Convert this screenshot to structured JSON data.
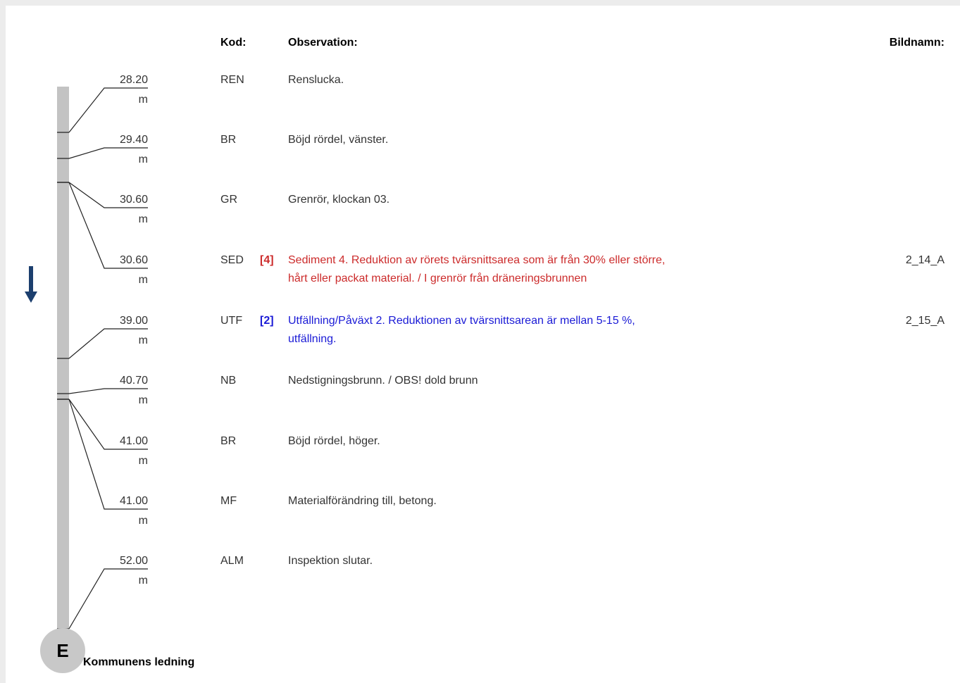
{
  "headers": {
    "code": "Kod:",
    "observation": "Observation:",
    "image_name": "Bildnamn:"
  },
  "colors": {
    "pipe": "#c3c3c3",
    "grade_4": "#cc2b2b",
    "grade_2": "#1a1ad6",
    "arrow": "#1c3f6e"
  },
  "rows": [
    {
      "distance": "28.20",
      "unit": "m",
      "code": "REN",
      "grade": "",
      "observation": "Renslucka.",
      "image": "",
      "color": ""
    },
    {
      "distance": "29.40",
      "unit": "m",
      "code": "BR",
      "grade": "",
      "observation": "Böjd rördel, vänster.",
      "image": "",
      "color": ""
    },
    {
      "distance": "30.60",
      "unit": "m",
      "code": "GR",
      "grade": "",
      "observation": "Grenrör, klockan 03.",
      "image": "",
      "color": ""
    },
    {
      "distance": "30.60",
      "unit": "m",
      "code": "SED",
      "grade": "[4]",
      "observation": "Sediment 4. Reduktion av rörets tvärsnittsarea som är från 30% eller större, hårt eller packat material. / I grenrör från dräneringsbrunnen",
      "image": "2_14_A",
      "color": "grade_4"
    },
    {
      "distance": "39.00",
      "unit": "m",
      "code": "UTF",
      "grade": "[2]",
      "observation": "Utfällning/Påväxt 2. Reduktionen av tvärsnittsarean är mellan 5-15 %, utfällning.",
      "image": "2_15_A",
      "color": "grade_2"
    },
    {
      "distance": "40.70",
      "unit": "m",
      "code": "NB",
      "grade": "",
      "observation": "Nedstigningsbrunn. / OBS! dold brunn",
      "image": "",
      "color": ""
    },
    {
      "distance": "41.00",
      "unit": "m",
      "code": "BR",
      "grade": "",
      "observation": "Böjd rördel, höger.",
      "image": "",
      "color": ""
    },
    {
      "distance": "41.00",
      "unit": "m",
      "code": "MF",
      "grade": "",
      "observation": "Materialförändring till, betong.",
      "image": "",
      "color": ""
    },
    {
      "distance": "52.00",
      "unit": "m",
      "code": "ALM",
      "grade": "",
      "observation": "Inspektion slutar.",
      "image": "",
      "color": ""
    }
  ],
  "end_node": {
    "letter": "E",
    "label": "Kommunens ledning"
  }
}
